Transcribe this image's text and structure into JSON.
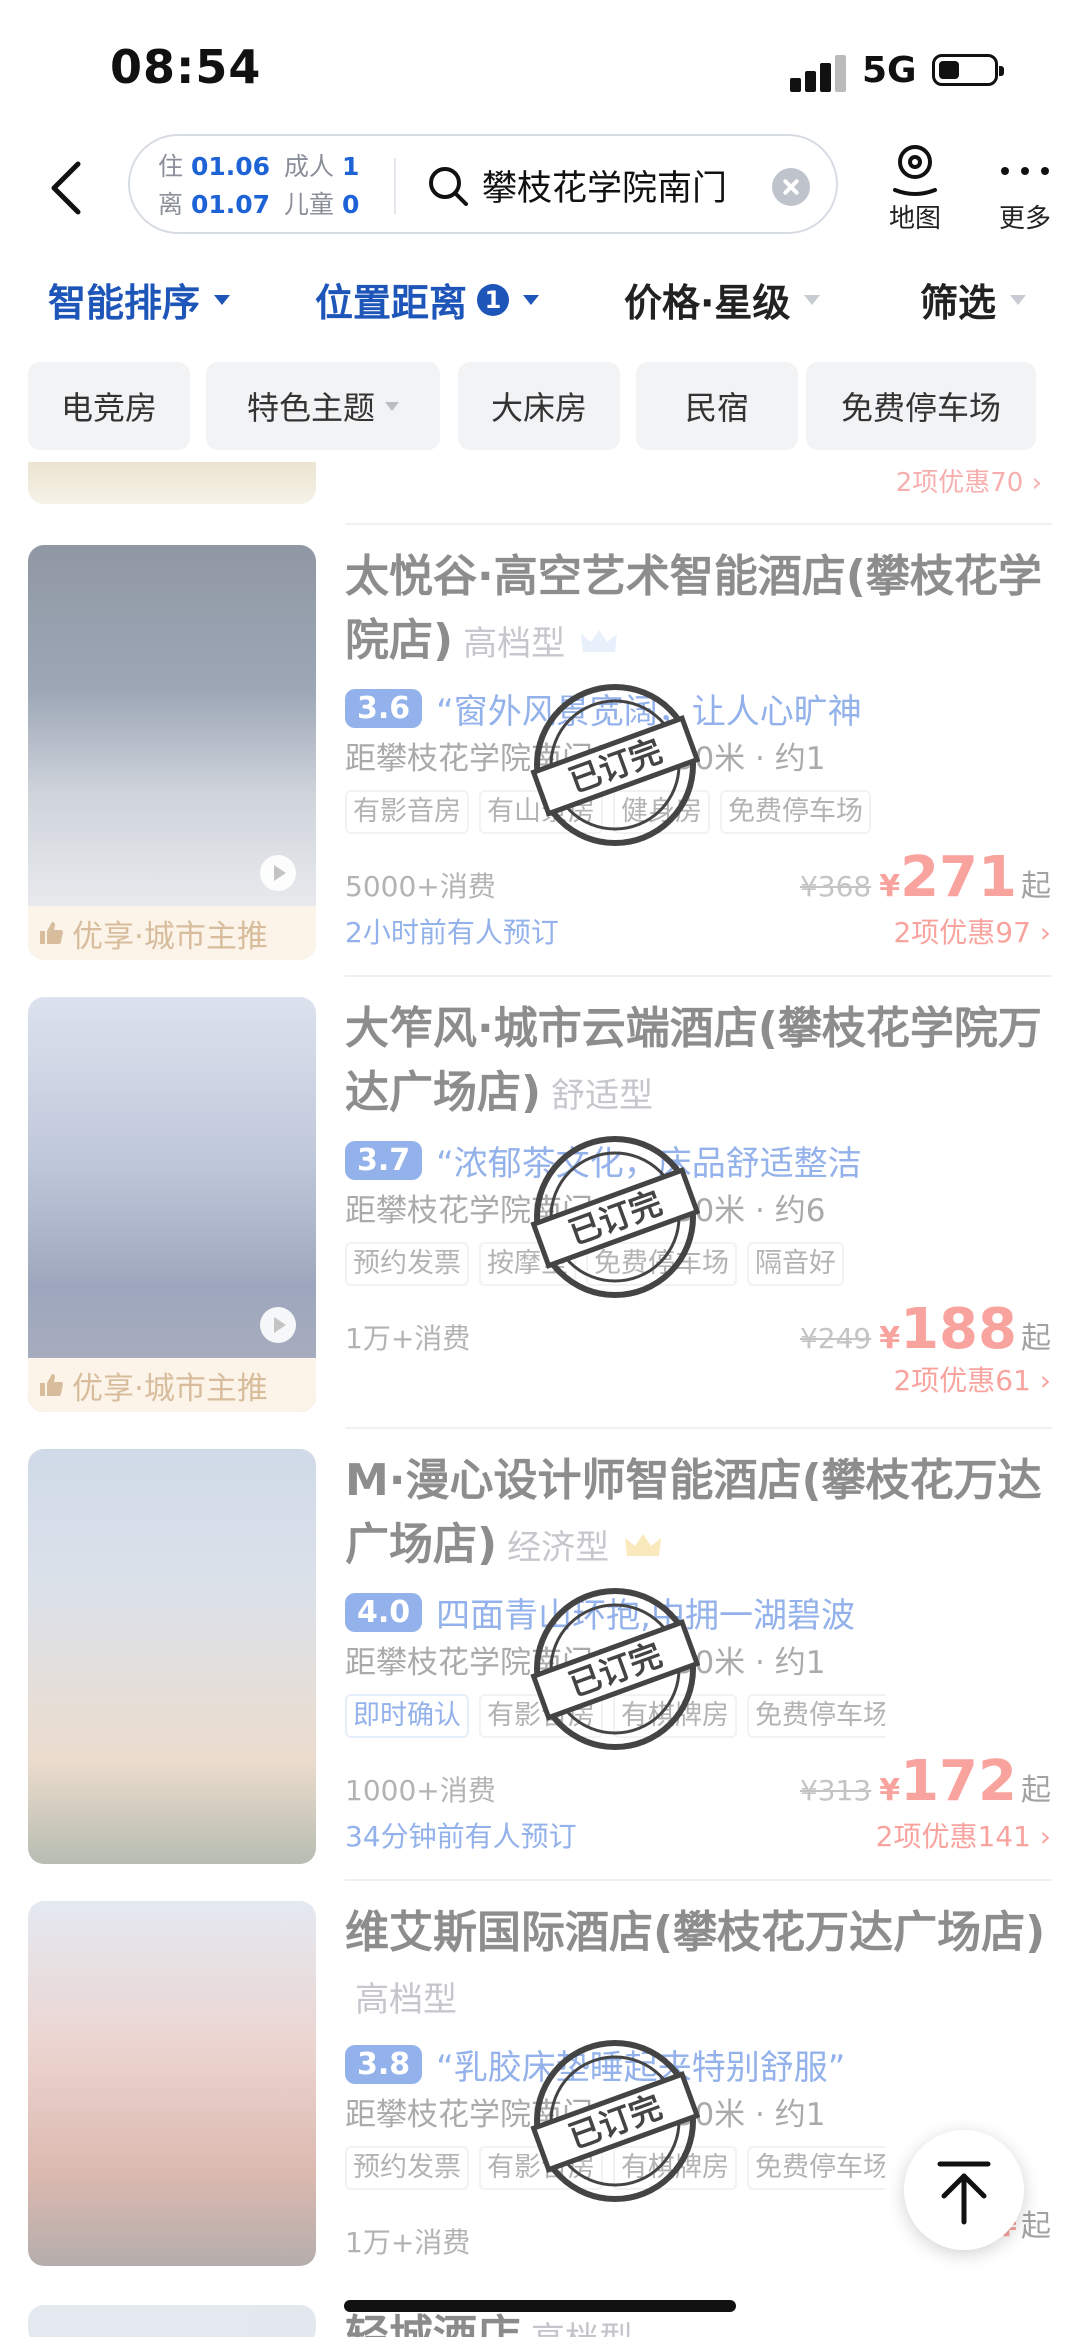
{
  "status": {
    "time": "08:54",
    "network": "5G"
  },
  "header": {
    "checkin_key": "住",
    "checkin": "01.06",
    "checkout_key": "离",
    "checkout": "01.07",
    "adults_key": "成人",
    "adults": "1",
    "children_key": "儿童",
    "children": "0",
    "search_text": "攀枝花学院南门",
    "map_label": "地图",
    "more_label": "更多"
  },
  "sort": {
    "smart": "智能排序",
    "distance": "位置距离",
    "distance_count": "1",
    "price": "价格·星级",
    "filter": "筛选"
  },
  "chips": [
    "电竞房",
    "特色主题",
    "大床房",
    "民宿",
    "免费停车场"
  ],
  "partial_top_promo": "2项优惠70",
  "stamp_text": "已订完",
  "hotels": [
    {
      "name": "太悦谷·高空艺术智能酒店(攀枝花学院店)",
      "grade": "高档型",
      "score": "3.6",
      "quote": "“窗外风景宽阔，让人心旷神",
      "distance": "距攀枝花学院南门步行850米 · 约1",
      "tags": [
        "有影音房",
        "有山景房",
        "健身房",
        "免费停车场"
      ],
      "consume": "5000+消费",
      "booked_note": "2小时前有人预订",
      "old_price": "¥368",
      "price": "271",
      "discount": "2项优惠97",
      "promo_tag": "优享·城市主推"
    },
    {
      "name": "大笮风·城市云端酒店(攀枝花学院万达广场店)",
      "grade": "舒适型",
      "score": "3.7",
      "quote": "“浓郁茶文化，床品舒适整洁",
      "distance": "距攀枝花学院南门步行450米 · 约6",
      "tags": [
        "预约发票",
        "按摩室",
        "免费停车场",
        "隔音好"
      ],
      "consume": "1万+消费",
      "old_price": "¥249",
      "price": "188",
      "discount": "2项优惠61",
      "promo_tag": "优享·城市主推"
    },
    {
      "name": "M·漫心设计师智能酒店(攀枝花万达广场店)",
      "grade": "经济型",
      "score": "4.0",
      "quote": "四面青山环抱,中拥一湖碧波",
      "distance": "距攀枝花学院南门步行950米 · 约1",
      "tags": [
        "即时确认",
        "有影音房",
        "有棋牌房",
        "免费停车场"
      ],
      "consume": "1000+消费",
      "booked_note": "34分钟前有人预订",
      "old_price": "¥313",
      "price": "172",
      "discount": "2项优惠141"
    },
    {
      "name": "维艾斯国际酒店(攀枝花万达广场店)",
      "grade": "高档型",
      "score": "3.8",
      "quote": "“乳胶床垫睡起来特别舒服”",
      "distance": "距攀枝花学院南门步行950米 · 约1",
      "tags": [
        "预约发票",
        "有影音房",
        "有棋牌房",
        "免费停车场"
      ],
      "consume": "1万+消费"
    }
  ],
  "partial_bottom": {
    "name": "轻城酒店",
    "grade": "高档型"
  },
  "colors": {
    "accent": "#1e55b8",
    "price": "#f2473d",
    "promo": "#f8e6d2"
  }
}
